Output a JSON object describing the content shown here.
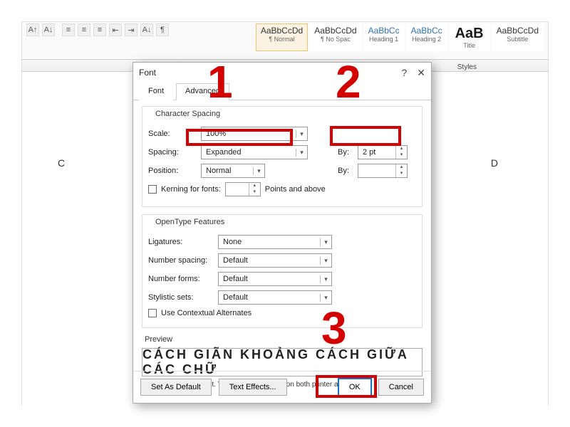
{
  "ribbon": {
    "styles_label": "Styles",
    "styles": [
      {
        "preview": "AaBbCcDd",
        "name": "¶ Normal",
        "sel": true,
        "cls": ""
      },
      {
        "preview": "AaBbCcDd",
        "name": "¶ No Spac",
        "sel": false,
        "cls": ""
      },
      {
        "preview": "AaBbCc",
        "name": "Heading 1",
        "sel": false,
        "cls": "bluep"
      },
      {
        "preview": "AaBbCc",
        "name": "Heading 2",
        "sel": false,
        "cls": "bluep"
      },
      {
        "preview": "AaB",
        "name": "Title",
        "sel": false,
        "cls": "bigb"
      },
      {
        "preview": "AaBbCcDd",
        "name": "Subtitle",
        "sel": false,
        "cls": ""
      }
    ]
  },
  "doc": {
    "left_char": "C",
    "right_char": "D"
  },
  "dialog": {
    "title": "Font",
    "help": "?",
    "close": "✕",
    "tabs": {
      "font": "Font",
      "advanced": "Advanced"
    },
    "char_spacing": {
      "group": "Character Spacing",
      "scale_label": "Scale:",
      "scale_value": "100%",
      "spacing_label": "Spacing:",
      "spacing_value": "Expanded",
      "by1_label": "By:",
      "by1_value": "2 pt",
      "position_label": "Position:",
      "position_value": "Normal",
      "by2_label": "By:",
      "by2_value": "",
      "kerning_label": "Kerning for fonts:",
      "kerning_value": "",
      "points_label": "Points and above"
    },
    "opentype": {
      "group": "OpenType Features",
      "ligatures_label": "Ligatures:",
      "ligatures_value": "None",
      "numspacing_label": "Number spacing:",
      "numspacing_value": "Default",
      "numforms_label": "Number forms:",
      "numforms_value": "Default",
      "stylistic_label": "Stylistic sets:",
      "stylistic_value": "Default",
      "contextual_label": "Use Contextual Alternates"
    },
    "preview": {
      "group": "Preview",
      "text": "CÁCH GIÃN KHOẢNG CÁCH GIỮA CÁC CHỮ",
      "hint": "This is a TrueType font. This font will be used on both printer and screen."
    },
    "buttons": {
      "default": "Set As Default",
      "effects": "Text Effects...",
      "ok": "OK",
      "cancel": "Cancel"
    }
  },
  "annotations": {
    "n1": "1",
    "n2": "2",
    "n3": "3"
  }
}
